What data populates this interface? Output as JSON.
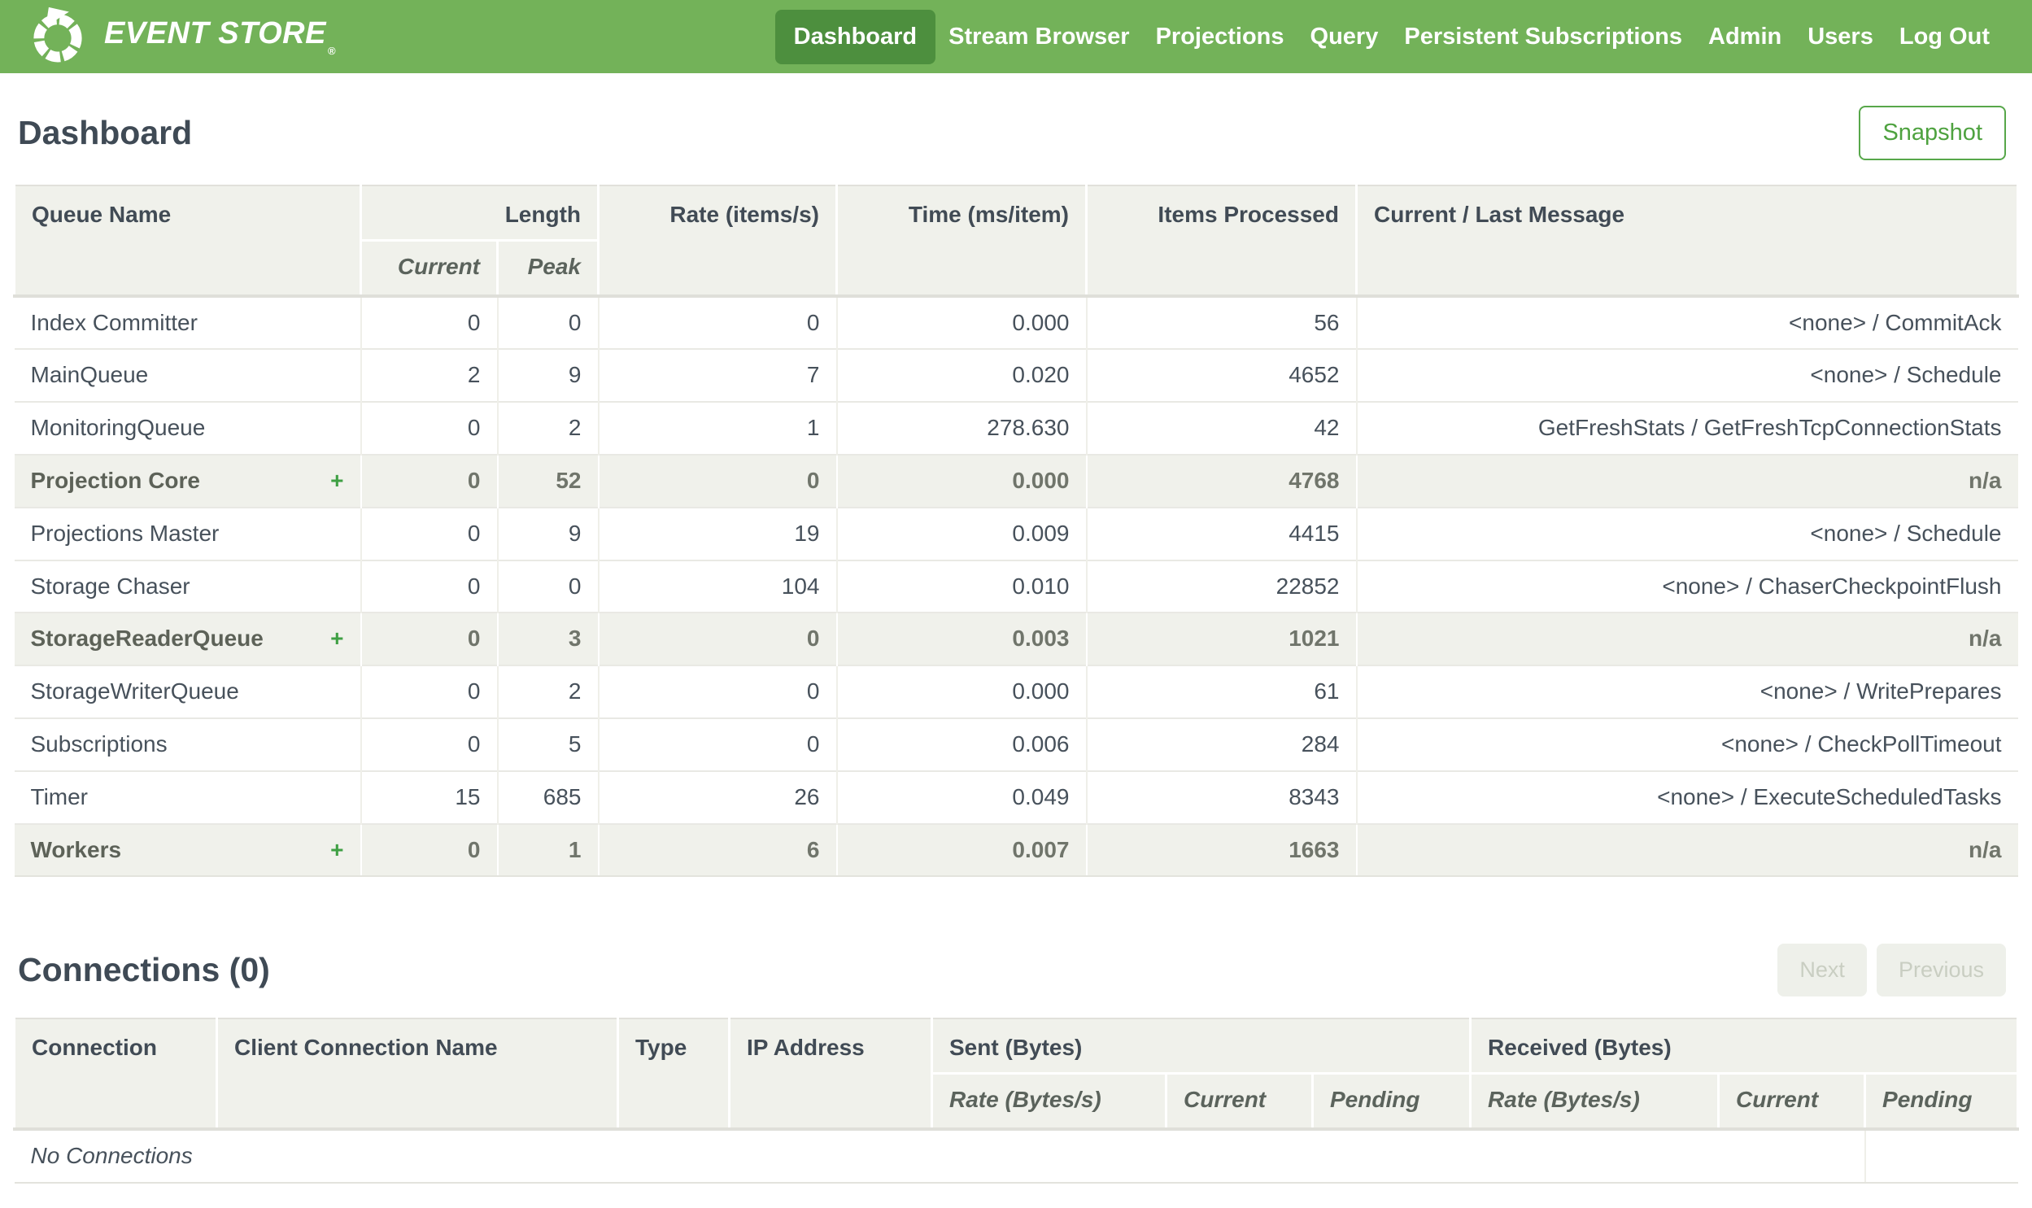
{
  "navbar": {
    "brand": "EVENT STORE",
    "brand_reg": "®",
    "items": [
      {
        "label": "Dashboard",
        "active": true
      },
      {
        "label": "Stream Browser",
        "active": false
      },
      {
        "label": "Projections",
        "active": false
      },
      {
        "label": "Query",
        "active": false
      },
      {
        "label": "Persistent Subscriptions",
        "active": false
      },
      {
        "label": "Admin",
        "active": false
      },
      {
        "label": "Users",
        "active": false
      },
      {
        "label": "Log Out",
        "active": false
      }
    ]
  },
  "page": {
    "title": "Dashboard",
    "snapshot_label": "Snapshot"
  },
  "queues": {
    "plus_label": "+",
    "headers": {
      "queue_name": "Queue Name",
      "length": "Length",
      "current": "Current",
      "peak": "Peak",
      "rate": "Rate (items/s)",
      "time": "Time (ms/item)",
      "items_processed": "Items Processed",
      "message": "Current / Last Message"
    },
    "rows": [
      {
        "name": "Index Committer",
        "group": false,
        "current": "0",
        "peak": "0",
        "rate": "0",
        "time": "0.000",
        "items": "56",
        "message": "<none> / CommitAck"
      },
      {
        "name": "MainQueue",
        "group": false,
        "current": "2",
        "peak": "9",
        "rate": "7",
        "time": "0.020",
        "items": "4652",
        "message": "<none> / Schedule"
      },
      {
        "name": "MonitoringQueue",
        "group": false,
        "current": "0",
        "peak": "2",
        "rate": "1",
        "time": "278.630",
        "items": "42",
        "message": "GetFreshStats / GetFreshTcpConnectionStats"
      },
      {
        "name": "Projection Core",
        "group": true,
        "current": "0",
        "peak": "52",
        "rate": "0",
        "time": "0.000",
        "items": "4768",
        "message": "n/a"
      },
      {
        "name": "Projections Master",
        "group": false,
        "current": "0",
        "peak": "9",
        "rate": "19",
        "time": "0.009",
        "items": "4415",
        "message": "<none> / Schedule"
      },
      {
        "name": "Storage Chaser",
        "group": false,
        "current": "0",
        "peak": "0",
        "rate": "104",
        "time": "0.010",
        "items": "22852",
        "message": "<none> / ChaserCheckpointFlush"
      },
      {
        "name": "StorageReaderQueue",
        "group": true,
        "current": "0",
        "peak": "3",
        "rate": "0",
        "time": "0.003",
        "items": "1021",
        "message": "n/a"
      },
      {
        "name": "StorageWriterQueue",
        "group": false,
        "current": "0",
        "peak": "2",
        "rate": "0",
        "time": "0.000",
        "items": "61",
        "message": "<none> / WritePrepares"
      },
      {
        "name": "Subscriptions",
        "group": false,
        "current": "0",
        "peak": "5",
        "rate": "0",
        "time": "0.006",
        "items": "284",
        "message": "<none> / CheckPollTimeout"
      },
      {
        "name": "Timer",
        "group": false,
        "current": "15",
        "peak": "685",
        "rate": "26",
        "time": "0.049",
        "items": "8343",
        "message": "<none> / ExecuteScheduledTasks"
      },
      {
        "name": "Workers",
        "group": true,
        "current": "0",
        "peak": "1",
        "rate": "6",
        "time": "0.007",
        "items": "1663",
        "message": "n/a"
      }
    ]
  },
  "connections": {
    "title": "Connections (0)",
    "next_label": "Next",
    "previous_label": "Previous",
    "headers": {
      "connection": "Connection",
      "client_name": "Client Connection Name",
      "type": "Type",
      "ip": "IP Address",
      "sent": "Sent (Bytes)",
      "received": "Received (Bytes)",
      "rate": "Rate (Bytes/s)",
      "current": "Current",
      "pending": "Pending"
    },
    "empty_message": "No Connections"
  },
  "colors": {
    "navbar_green": "#73b259",
    "active_tab_green": "#4d8f3e",
    "accent_green": "#4ea23f",
    "plus_green": "#3fa044",
    "table_header_bg": "#f0f1eb",
    "text_slate": "#47515b"
  }
}
